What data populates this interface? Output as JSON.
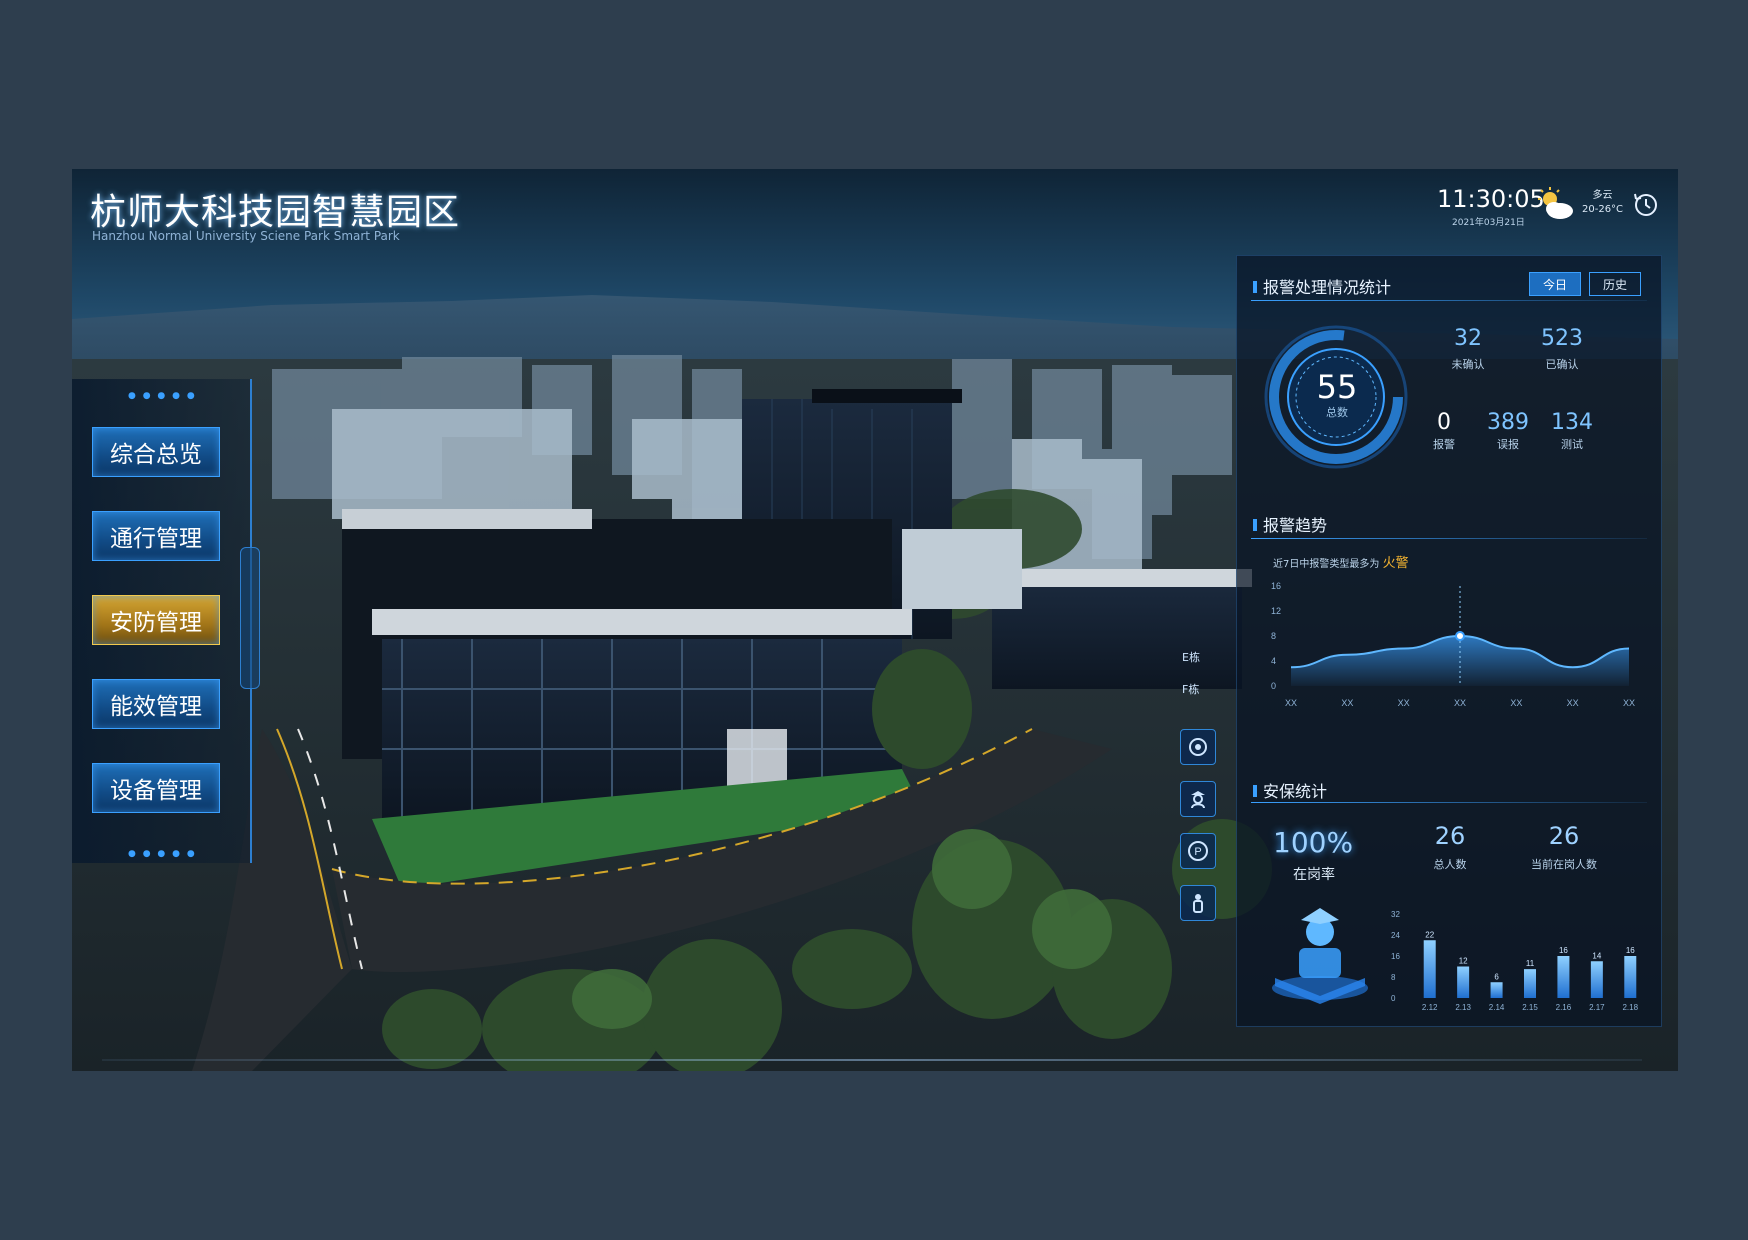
{
  "header": {
    "title": "杭师大科技园智慧园区",
    "subtitle": "Hanzhou Normal University Sciene Park Smart Park",
    "time": "11:30:05",
    "date": "2021年03月21日",
    "weather_condition": "多云",
    "temperature": "20-26°C",
    "icons": [
      "partly-cloudy-icon",
      "history-clock-icon"
    ]
  },
  "nav": {
    "items": [
      {
        "label": "综合总览",
        "active": false
      },
      {
        "label": "通行管理",
        "active": false
      },
      {
        "label": "安防管理",
        "active": true
      },
      {
        "label": "能效管理",
        "active": false
      },
      {
        "label": "设备管理",
        "active": false
      }
    ]
  },
  "toolbar": {
    "icons": [
      "camera-icon",
      "guard-icon",
      "parking-icon",
      "person-icon"
    ]
  },
  "building_labels": {
    "floor_e": "E栋",
    "floor_f": "F栋"
  },
  "alarm_stats": {
    "title": "报警处理情况统计",
    "tabs": [
      "今日",
      "历史"
    ],
    "active_tab": "今日",
    "total": {
      "value": "55",
      "label": "总数"
    },
    "unconfirmed": {
      "value": "32",
      "label": "未确认"
    },
    "confirmed": {
      "value": "523",
      "label": "已确认"
    },
    "alarm": {
      "value": "0",
      "label": "报警"
    },
    "false_report": {
      "value": "389",
      "label": "误报"
    },
    "test": {
      "value": "134",
      "label": "测试"
    }
  },
  "alarm_trend": {
    "title": "报警趋势",
    "note_prefix": "近7日中报警类型最多为",
    "note_highlight": "火警"
  },
  "security_stats": {
    "title": "安保统计",
    "on_duty_rate": {
      "value": "100%",
      "label": "在岗率"
    },
    "total_people": {
      "value": "26",
      "label": "总人数"
    },
    "current_on_duty": {
      "value": "26",
      "label": "当前在岗人数"
    }
  },
  "colors": {
    "accent": "#3aa0ff",
    "active_nav": "#d5a633",
    "highlight": "#f2b230",
    "panel_bg": "#08142490"
  },
  "chart_data": [
    {
      "type": "area",
      "title": "报警趋势",
      "categories": [
        "XX",
        "XX",
        "XX",
        "XX",
        "XX",
        "XX",
        "XX"
      ],
      "y_ticks": [
        0,
        4,
        8,
        12,
        16
      ],
      "ylim": [
        0,
        16
      ],
      "series": [
        {
          "values": [
            3,
            5,
            6,
            8,
            6,
            3,
            6
          ]
        }
      ],
      "highlight_index": 3,
      "grid": false
    },
    {
      "type": "bar",
      "categories": [
        "2.12",
        "2.13",
        "2.14",
        "2.15",
        "2.16",
        "2.17",
        "2.18"
      ],
      "values": [
        22,
        12,
        6,
        11,
        16,
        14,
        16
      ],
      "y_ticks": [
        0,
        8,
        16,
        24,
        32
      ],
      "ylim": [
        0,
        32
      ],
      "grid": false
    }
  ]
}
